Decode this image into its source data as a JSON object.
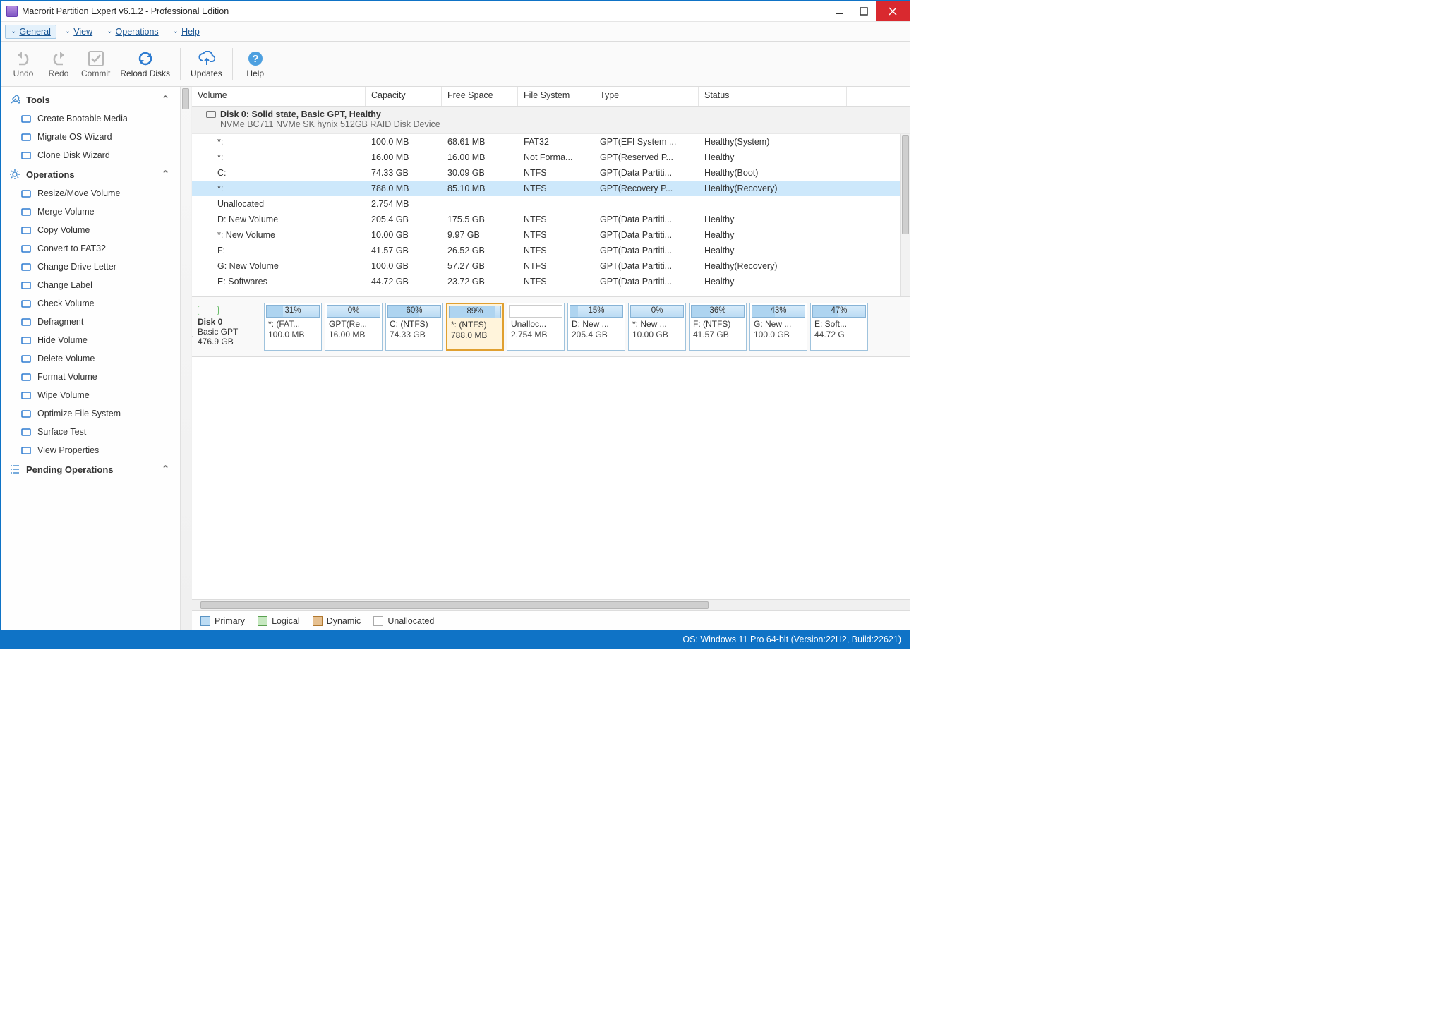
{
  "window": {
    "title": "Macrorit Partition Expert v6.1.2 - Professional Edition"
  },
  "menu": {
    "general": "General",
    "view": "View",
    "operations": "Operations",
    "help": "Help"
  },
  "toolbar": {
    "undo": "Undo",
    "redo": "Redo",
    "commit": "Commit",
    "reload": "Reload Disks",
    "updates": "Updates",
    "help": "Help"
  },
  "sidebar": {
    "tools_head": "Tools",
    "tools": [
      {
        "label": "Create Bootable Media",
        "icon": "usb-icon",
        "color": "#2e7cd1"
      },
      {
        "label": "Migrate OS Wizard",
        "icon": "migrate-icon",
        "color": "#2e7cd1"
      },
      {
        "label": "Clone Disk Wizard",
        "icon": "clone-icon",
        "color": "#2e7cd1"
      }
    ],
    "ops_head": "Operations",
    "ops": [
      {
        "label": "Resize/Move Volume",
        "icon": "resize-icon",
        "color": "#2e7cd1"
      },
      {
        "label": "Merge Volume",
        "icon": "merge-icon",
        "color": "#2e7cd1"
      },
      {
        "label": "Copy Volume",
        "icon": "copy-icon",
        "color": "#2e7cd1"
      },
      {
        "label": "Convert to FAT32",
        "icon": "convert-icon",
        "color": "#2e7cd1"
      },
      {
        "label": "Change Drive Letter",
        "icon": "letter-icon",
        "color": "#2e7cd1"
      },
      {
        "label": "Change Label",
        "icon": "label-icon",
        "color": "#2e7cd1"
      },
      {
        "label": "Check Volume",
        "icon": "check-icon",
        "color": "#2e7cd1"
      },
      {
        "label": "Defragment",
        "icon": "defrag-icon",
        "color": "#2e7cd1"
      },
      {
        "label": "Hide Volume",
        "icon": "hide-icon",
        "color": "#2e7cd1"
      },
      {
        "label": "Delete Volume",
        "icon": "delete-icon",
        "color": "#2e7cd1"
      },
      {
        "label": "Format Volume",
        "icon": "format-icon",
        "color": "#2e7cd1"
      },
      {
        "label": "Wipe Volume",
        "icon": "wipe-icon",
        "color": "#2e7cd1"
      },
      {
        "label": "Optimize File System",
        "icon": "optimize-icon",
        "color": "#2e7cd1"
      },
      {
        "label": "Surface Test",
        "icon": "surface-icon",
        "color": "#2e7cd1"
      },
      {
        "label": "View Properties",
        "icon": "props-icon",
        "color": "#2e7cd1"
      }
    ],
    "pending_head": "Pending Operations"
  },
  "columns": {
    "volume": "Volume",
    "capacity": "Capacity",
    "free": "Free Space",
    "fs": "File System",
    "type": "Type",
    "status": "Status"
  },
  "disk": {
    "title": "Disk 0: Solid state, Basic GPT, Healthy",
    "sub": "NVMe BC711 NVMe SK hynix 512GB RAID Disk Device",
    "label": "Disk 0",
    "basic": "Basic GPT",
    "size": "476.9 GB"
  },
  "volumes": [
    {
      "v": "*:",
      "cap": "100.0 MB",
      "free": "68.61 MB",
      "fs": "FAT32",
      "type": "GPT(EFI System ...",
      "status": "Healthy(System)",
      "sel": false
    },
    {
      "v": "*:",
      "cap": "16.00 MB",
      "free": "16.00 MB",
      "fs": "Not Forma...",
      "type": "GPT(Reserved P...",
      "status": "Healthy",
      "sel": false
    },
    {
      "v": "C:",
      "cap": "74.33 GB",
      "free": "30.09 GB",
      "fs": "NTFS",
      "type": "GPT(Data Partiti...",
      "status": "Healthy(Boot)",
      "sel": false
    },
    {
      "v": "*:",
      "cap": "788.0 MB",
      "free": "85.10 MB",
      "fs": "NTFS",
      "type": "GPT(Recovery P...",
      "status": "Healthy(Recovery)",
      "sel": true
    },
    {
      "v": "Unallocated",
      "cap": "2.754 MB",
      "free": "",
      "fs": "",
      "type": "",
      "status": "",
      "sel": false
    },
    {
      "v": "D: New Volume",
      "cap": "205.4 GB",
      "free": "175.5 GB",
      "fs": "NTFS",
      "type": "GPT(Data Partiti...",
      "status": "Healthy",
      "sel": false
    },
    {
      "v": "*: New Volume",
      "cap": "10.00 GB",
      "free": "9.97 GB",
      "fs": "NTFS",
      "type": "GPT(Data Partiti...",
      "status": "Healthy",
      "sel": false
    },
    {
      "v": "F:",
      "cap": "41.57 GB",
      "free": "26.52 GB",
      "fs": "NTFS",
      "type": "GPT(Data Partiti...",
      "status": "Healthy",
      "sel": false
    },
    {
      "v": "G: New Volume",
      "cap": "100.0 GB",
      "free": "57.27 GB",
      "fs": "NTFS",
      "type": "GPT(Data Partiti...",
      "status": "Healthy(Recovery)",
      "sel": false
    },
    {
      "v": "E: Softwares",
      "cap": "44.72 GB",
      "free": "23.72 GB",
      "fs": "NTFS",
      "type": "GPT(Data Partiti...",
      "status": "Healthy",
      "sel": false
    },
    {
      "v": "",
      "cap": "",
      "free": "",
      "fs": ".....",
      "type": "",
      "status": "",
      "sel": false
    }
  ],
  "segments": [
    {
      "pct": "31%",
      "fill": 31,
      "t1": "*: (FAT...",
      "t2": "100.0 MB",
      "sel": false,
      "unalloc": false
    },
    {
      "pct": "0%",
      "fill": 0,
      "t1": "GPT(Re...",
      "t2": "16.00 MB",
      "sel": false,
      "unalloc": false
    },
    {
      "pct": "60%",
      "fill": 60,
      "t1": "C: (NTFS)",
      "t2": "74.33 GB",
      "sel": false,
      "unalloc": false
    },
    {
      "pct": "89%",
      "fill": 89,
      "t1": "*: (NTFS)",
      "t2": "788.0 MB",
      "sel": true,
      "unalloc": false
    },
    {
      "pct": "",
      "fill": 0,
      "t1": "Unalloc...",
      "t2": "2.754 MB",
      "sel": false,
      "unalloc": true
    },
    {
      "pct": "15%",
      "fill": 15,
      "t1": "D: New ...",
      "t2": "205.4 GB",
      "sel": false,
      "unalloc": false
    },
    {
      "pct": "0%",
      "fill": 0,
      "t1": "*: New ...",
      "t2": "10.00 GB",
      "sel": false,
      "unalloc": false
    },
    {
      "pct": "36%",
      "fill": 36,
      "t1": "F: (NTFS)",
      "t2": "41.57 GB",
      "sel": false,
      "unalloc": false
    },
    {
      "pct": "43%",
      "fill": 43,
      "t1": "G: New ...",
      "t2": "100.0 GB",
      "sel": false,
      "unalloc": false
    },
    {
      "pct": "47%",
      "fill": 47,
      "t1": "E: Soft...",
      "t2": "44.72 G",
      "sel": false,
      "unalloc": false
    }
  ],
  "legend": {
    "primary": "Primary",
    "logical": "Logical",
    "dynamic": "Dynamic",
    "unalloc": "Unallocated"
  },
  "status": "OS: Windows 11 Pro 64-bit (Version:22H2, Build:22621)"
}
